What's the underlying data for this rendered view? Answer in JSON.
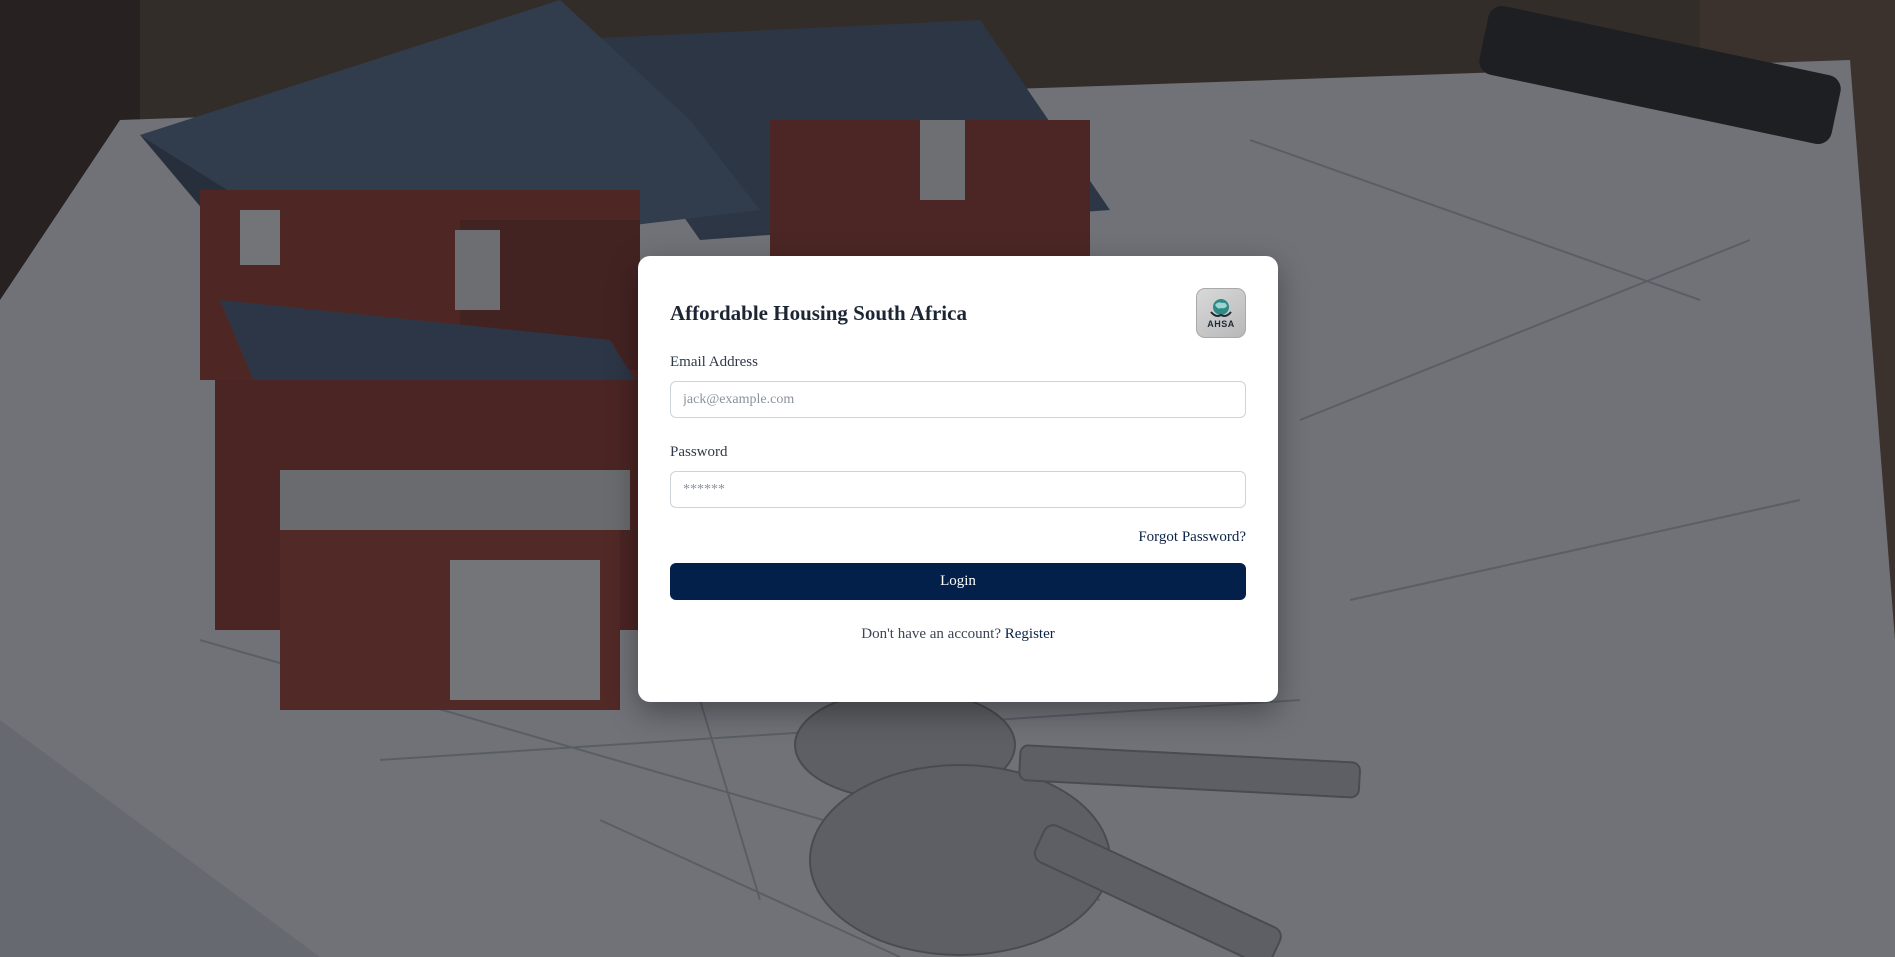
{
  "background": {
    "description_icon": "house-model-photo"
  },
  "card": {
    "title": "Affordable Housing South Africa",
    "logo_text": "AHSA",
    "email": {
      "label": "Email Address",
      "placeholder": "jack@example.com",
      "value": ""
    },
    "password": {
      "label": "Password",
      "placeholder": "******",
      "value": ""
    },
    "forgot_password": "Forgot Password?",
    "login_button": "Login",
    "register_prompt": "Don't have an account?",
    "register_link": "Register"
  },
  "colors": {
    "primary": "#03204a",
    "link": "#0b2347",
    "card_bg": "#ffffff"
  }
}
